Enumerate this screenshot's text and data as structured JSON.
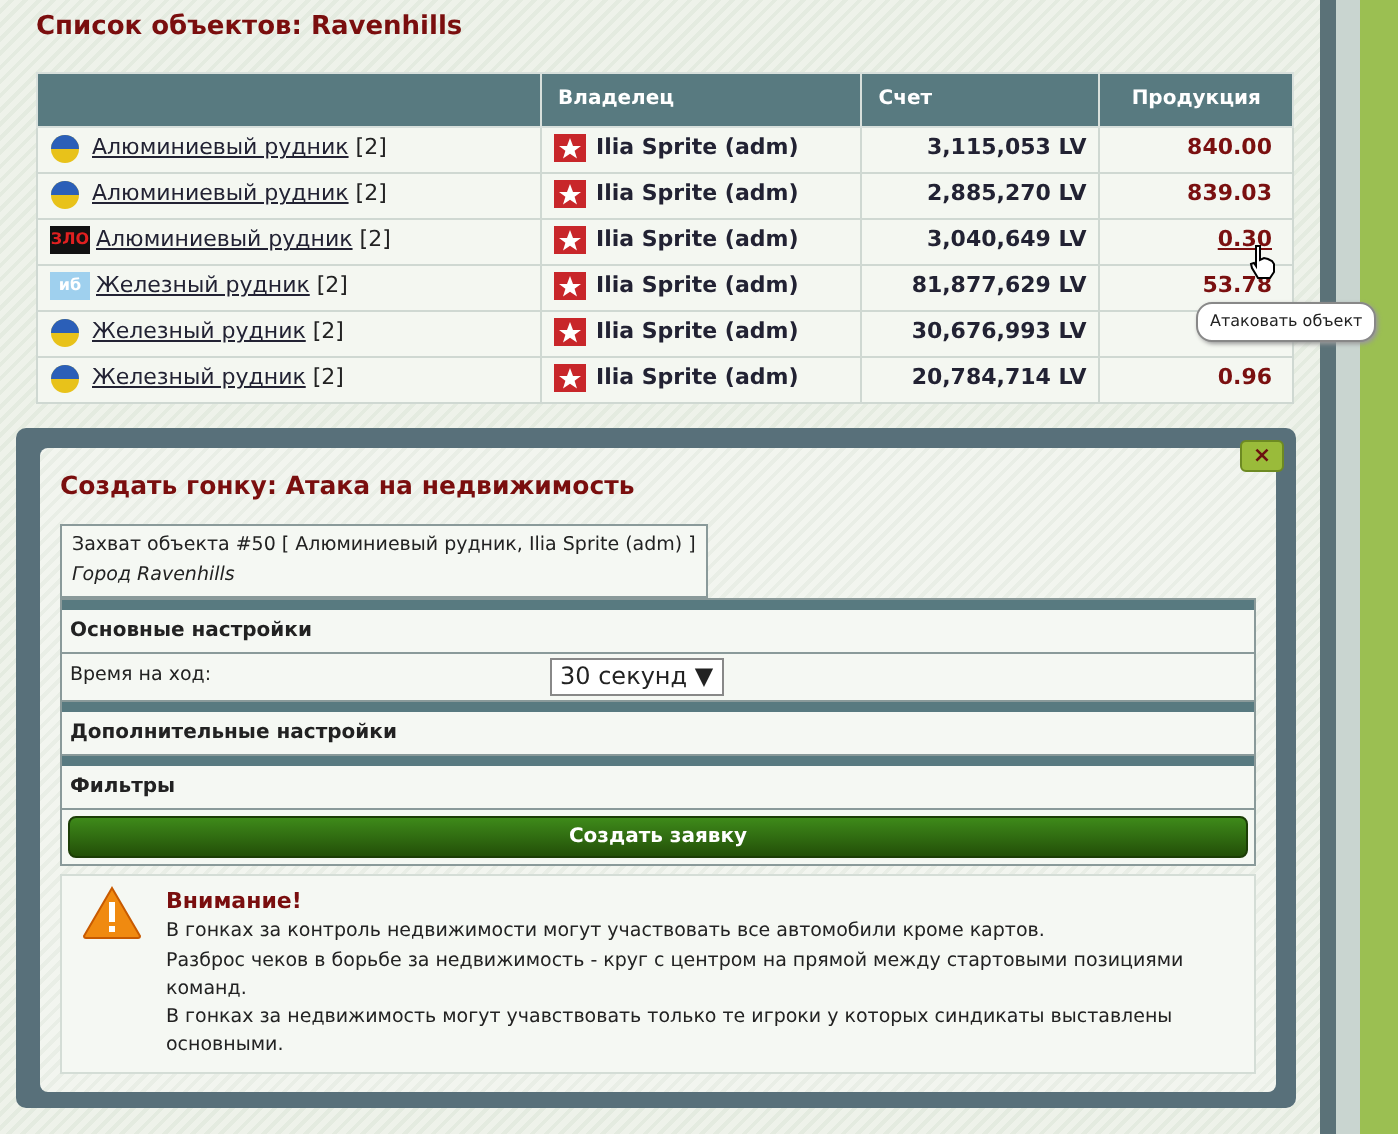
{
  "page_title": "Список объектов: Ravenhills",
  "table": {
    "columns": [
      "",
      "Владелец",
      "Счет",
      "Продукция"
    ],
    "rows": [
      {
        "emblem": {
          "kind": "flag"
        },
        "object": "Алюминиевый рудник",
        "count": "[2]",
        "owner": "Ilia Sprite (adm)",
        "score": "3,115,053 LV",
        "production": "840.00"
      },
      {
        "emblem": {
          "kind": "flag"
        },
        "object": "Алюминиевый рудник",
        "count": "[2]",
        "owner": "Ilia Sprite (adm)",
        "score": "2,885,270 LV",
        "production": "839.03"
      },
      {
        "emblem": {
          "kind": "dark",
          "text": "ЗЛО"
        },
        "object": "Алюминиевый рудник",
        "count": "[2]",
        "owner": "Ilia Sprite (adm)",
        "score": "3,040,649 LV",
        "production": "0.30",
        "hovered": true
      },
      {
        "emblem": {
          "kind": "light",
          "text": "иб"
        },
        "object": "Железный рудник",
        "count": "[2]",
        "owner": "Ilia Sprite (adm)",
        "score": "81,877,629 LV",
        "production": "53.78"
      },
      {
        "emblem": {
          "kind": "flag"
        },
        "object": "Железный рудник",
        "count": "[2]",
        "owner": "Ilia Sprite (adm)",
        "score": "30,676,993 LV",
        "production": ""
      },
      {
        "emblem": {
          "kind": "flag"
        },
        "object": "Железный рудник",
        "count": "[2]",
        "owner": "Ilia Sprite (adm)",
        "score": "20,784,714 LV",
        "production": "0.96"
      }
    ]
  },
  "tooltip": "Атаковать объект",
  "dialog": {
    "title": "Создать гонку: Атака на недвижимость",
    "close": "×",
    "target": "Захват объекта #50 [ Алюминиевый рудник, Ilia Sprite (adm) ]",
    "city": "Город Ravenhills",
    "sections": [
      {
        "kind": "header",
        "label": "Основные настройки"
      },
      {
        "kind": "select",
        "label": "Время на ход:",
        "value": "30 секунд",
        "arrow": "▼"
      },
      {
        "kind": "header",
        "label": "Дополнительные настройки"
      },
      {
        "kind": "header",
        "label": "Фильтры"
      }
    ],
    "submit": "Создать заявку",
    "warning": {
      "title": "Внимание!",
      "lines": [
        "В гонках за контроль недвижимости могут участвовать все автомобили кроме картов.",
        "Разброс чеков в борьбе за недвижимость - круг с центром на прямой между стартовыми позициями команд.",
        "В гонках за недвижимость могут учавствовать только те игроки у которых синдикаты выставлены основными."
      ]
    }
  }
}
